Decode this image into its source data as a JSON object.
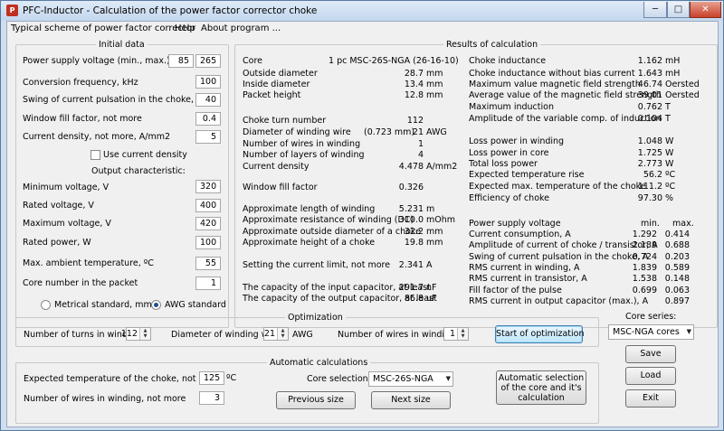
{
  "window": {
    "title": "PFC-Inductor - Calculation of the power factor corrector choke",
    "icon": "pfc-app-icon",
    "minimize_glyph": "─",
    "maximize_glyph": "□",
    "close_glyph": "✕"
  },
  "menu": [
    "Typical scheme of power factor corrector",
    "Help",
    "About program ..."
  ],
  "initial": {
    "title": "Initial data",
    "supply_label": "Power supply voltage (min., max.), V",
    "supply_min": "85",
    "supply_max": "265",
    "freq_label": "Conversion frequency, kHz",
    "freq": "100",
    "swing_label": "Swing of current pulsation in the choke, %",
    "swing": "40",
    "fill_label": "Window fill factor, not more",
    "fill": "0.4",
    "density_label": "Current density, not more, A/mm2",
    "density": "5",
    "use_density_label": "Use current density",
    "output_title": "Output characteristic:",
    "vmin_label": "Minimum voltage, V",
    "vmin": "320",
    "vrated_label": "Rated voltage, V",
    "vrated": "400",
    "vmax_label": "Maximum voltage, V",
    "vmax": "420",
    "power_label": "Rated power, W",
    "power": "100",
    "ambient_label": "Max. ambient temperature, ºC",
    "ambient": "55",
    "corenum_label": "Core number in the packet",
    "corenum": "1",
    "metric_label": "Metrical standard, mm",
    "awg_label": "AWG standard"
  },
  "results": {
    "title": "Results of calculation",
    "left": [
      {
        "label": "Core",
        "value": "1 pc MSC-26S-NGA (26-16-10)",
        "unit": ""
      },
      {
        "label": "Outside diameter",
        "value": "28.7",
        "unit": "mm"
      },
      {
        "label": "Inside diameter",
        "value": "13.4",
        "unit": "mm"
      },
      {
        "label": "Packet height",
        "value": "12.8",
        "unit": "mm"
      },
      {
        "label": "Choke turn number",
        "value": "112",
        "unit": ""
      },
      {
        "label": "Diameter of winding wire",
        "extra": "(0.723 mm)",
        "value": "21",
        "unit": "AWG"
      },
      {
        "label": "Number of wires in winding",
        "value": "1",
        "unit": ""
      },
      {
        "label": "Number of layers of winding",
        "value": "4",
        "unit": ""
      },
      {
        "label": "Current density",
        "value": "4.478",
        "unit": "A/mm2"
      },
      {
        "label": "Window fill factor",
        "value": "0.326",
        "unit": ""
      },
      {
        "label": "Approximate length of winding",
        "value": "5.231",
        "unit": "m"
      },
      {
        "label": "Approximate resistance of winding (DC)",
        "value": "310.0",
        "unit": "mOhm"
      },
      {
        "label": "Approximate outside diameter of a choke",
        "value": "32.2",
        "unit": "mm"
      },
      {
        "label": "Approximate height of a choke",
        "value": "19.8",
        "unit": "mm"
      },
      {
        "label": "Setting the current limit, not more",
        "value": "2.341",
        "unit": "A"
      },
      {
        "label": "The capacity of the input capacitor, at least",
        "value": "291.7",
        "unit": "nF"
      },
      {
        "label": "The capacity of the output capacitor, at least",
        "value": "86.8",
        "unit": "uF"
      }
    ],
    "right": [
      {
        "label": "Choke inductance",
        "value": "1.162",
        "unit": "mH"
      },
      {
        "label": "Choke inductance without bias current",
        "value": "1.643",
        "unit": "mH"
      },
      {
        "label": "Maximum value magnetic field strength",
        "value": "46.74",
        "unit": "Oersted"
      },
      {
        "label": "Average value of the magnetic field strength",
        "value": "39.01",
        "unit": "Oersted"
      },
      {
        "label": "Maximum induction",
        "value": "0.762",
        "unit": "T"
      },
      {
        "label": "Amplitude of the variable comp. of induction",
        "value": "0.104",
        "unit": "T"
      },
      {
        "label": "Loss power in winding",
        "value": "1.048",
        "unit": "W"
      },
      {
        "label": "Loss power in core",
        "value": "1.725",
        "unit": "W"
      },
      {
        "label": "Total loss power",
        "value": "2.773",
        "unit": "W"
      },
      {
        "label": "Expected temperature rise",
        "value": "56.2",
        "unit": "ºC"
      },
      {
        "label": "Expected max. temperature of the choke",
        "value": "111.2",
        "unit": "ºC"
      },
      {
        "label": "Efficiency of choke",
        "value": "97.30",
        "unit": "%"
      }
    ],
    "supply_label": "Power supply voltage",
    "min_header": "min.",
    "max_header": "max.",
    "supply_rows": [
      {
        "label": "Current consumption, A",
        "min": "1.292",
        "max": "0.414"
      },
      {
        "label": "Amplitude of current of choke / transistor, A",
        "min": "2.189",
        "max": "0.688"
      },
      {
        "label": "Swing of current pulsation in the choke, A",
        "min": "0.724",
        "max": "0.203"
      },
      {
        "label": "RMS current in winding, A",
        "min": "1.839",
        "max": "0.589"
      },
      {
        "label": "RMS current in transistor, A",
        "min": "1.538",
        "max": "0.148"
      },
      {
        "label": "Fill factor of the pulse",
        "min": "0.699",
        "max": "0.063"
      },
      {
        "label": "RMS current in output capacitor (max.), A",
        "min": "",
        "max": "0.897"
      }
    ]
  },
  "optimization": {
    "title": "Optimization",
    "turns_label": "Number of turns in winding",
    "turns": "112",
    "diam_label": "Diameter of winding wire",
    "diam": "21",
    "awg_unit": "AWG",
    "wires_label": "Number of wires in winding",
    "wires": "1",
    "start_label": "Start of optimization"
  },
  "auto": {
    "title": "Automatic calculations",
    "temp_label": "Expected temperature of the choke, not more",
    "temp": "125",
    "temp_unit": "ºC",
    "wires_label": "Number of wires in winding, not more",
    "wires": "3",
    "core_sel_label": "Core selection:",
    "core_sel": "MSC-26S-NGA",
    "prev_label": "Previous size",
    "next_label": "Next size",
    "auto_btn_label": "Automatic selection of the core and it's calculation"
  },
  "core_series": {
    "label": "Core series:",
    "value": "MSC-NGA cores",
    "save_label": "Save",
    "load_label": "Load",
    "exit_label": "Exit"
  }
}
